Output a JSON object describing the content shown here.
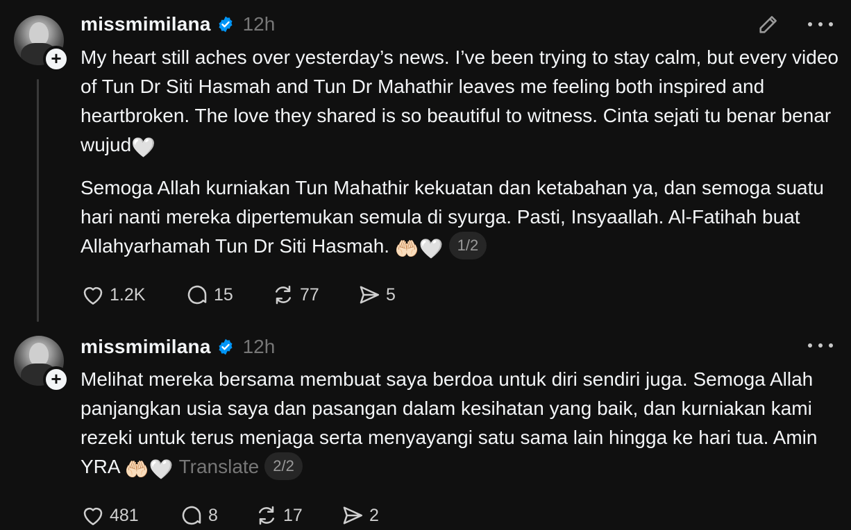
{
  "posts": [
    {
      "username": "missmimilana",
      "time": "12h",
      "paragraphs": [
        "My heart still aches over yesterday’s news. I’ve been trying to stay calm, but every video of Tun Dr Siti Hasmah and Tun Dr Mahathir leaves me feeling both inspired and heartbroken. The love they shared is so beautiful to witness. Cinta sejati tu benar benar wujud",
        "Semoga Allah kurniakan Tun Mahathir kekuatan dan ketabahan ya, dan semoga suatu hari nanti mereka dipertemukan semula di syurga. Pasti, Insyaallah. Al-Fatihah buat Allahyarhamah Tun Dr Siti Hasmah. "
      ],
      "emoji_heart": "🤍",
      "emoji_hands": "🤲🏻",
      "page": "1/2",
      "likes": "1.2K",
      "replies": "15",
      "reposts": "77",
      "shares": "5"
    },
    {
      "username": "missmimilana",
      "time": "12h",
      "paragraphs": [
        "Melihat mereka bersama membuat saya berdoa untuk diri sendiri juga. Semoga Allah panjangkan usia saya dan pasangan dalam kesihatan yang baik, dan kurniakan kami rezeki untuk terus menjaga serta menyayangi satu sama lain hingga ke hari tua. Amin YRA "
      ],
      "emoji_heart": "🤍",
      "emoji_hands": "🤲🏻",
      "translate": "Translate",
      "page": "2/2",
      "likes": "481",
      "replies": "8",
      "reposts": "17",
      "shares": "2"
    }
  ],
  "icons": {
    "verified": "verified-badge-icon",
    "edit": "pencil-icon",
    "more": "more-options-icon",
    "like": "heart-icon",
    "reply": "comment-icon",
    "repost": "repost-icon",
    "share": "send-icon"
  },
  "colors": {
    "background": "#101010",
    "text": "#f3f5f7",
    "muted": "#777777",
    "verified": "#0095f6"
  }
}
